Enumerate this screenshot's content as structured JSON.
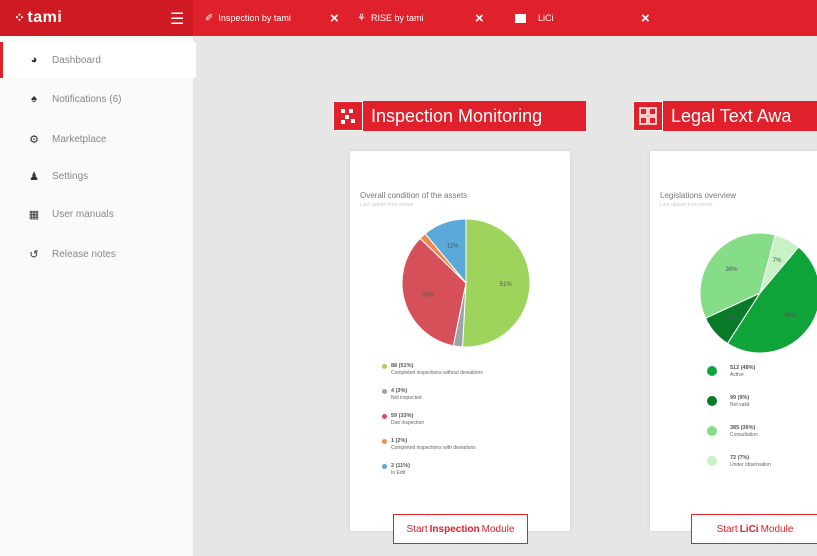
{
  "app": {
    "name": "tami"
  },
  "tabs": [
    {
      "label": "Inspection by tami",
      "icon": "inspection-icon"
    },
    {
      "label": "RISE by tami",
      "icon": "rise-icon"
    },
    {
      "label": "LiCi",
      "icon": "lici-icon"
    }
  ],
  "sidebar": {
    "items": [
      {
        "label": "Dashboard",
        "icon": "dashboard-icon",
        "active": true
      },
      {
        "label": "Notifications (6)",
        "icon": "bell-icon"
      },
      {
        "label": "Marketplace",
        "icon": "marketplace-icon"
      },
      {
        "label": "Settings",
        "icon": "users-settings-icon"
      },
      {
        "label": "User manuals",
        "icon": "manual-icon"
      },
      {
        "label": "Release notes",
        "icon": "history-icon"
      }
    ]
  },
  "modules": {
    "inspection": {
      "title": "Inspection Monitoring",
      "card_title": "Overall condition of the assets",
      "card_subtitle": "Last update from vessel",
      "button": {
        "prefix": "Start",
        "bold": "Inspection",
        "suffix": "Module"
      }
    },
    "legal": {
      "title": "Legal Text Awa",
      "card_title": "Legislations overview",
      "card_subtitle": "Last update from server",
      "button": {
        "prefix": "Start",
        "bold": "LiCi",
        "suffix": "Module"
      }
    }
  },
  "chart_data": [
    {
      "type": "pie",
      "title": "Overall condition of the assets",
      "series": [
        {
          "label": "Completed inspections without deviations",
          "value": 88,
          "display": "88 (51%)",
          "slice_label": "51%",
          "color": "#9ed35c"
        },
        {
          "label": "Not inspected",
          "value": 4,
          "display": "4 (3%)",
          "color": "#9aa4aa"
        },
        {
          "label": "Due inspection",
          "value": 59,
          "display": "59 (33%)",
          "slice_label": "33%",
          "color": "#d6505a"
        },
        {
          "label": "Completed inspections with deviations",
          "value": 3,
          "display": "1 (2%)",
          "color": "#f28a4a"
        },
        {
          "label": "In Edit",
          "value": 19,
          "display": "2 (11%)",
          "slice_label": "11%",
          "color": "#5aa9d8"
        }
      ]
    },
    {
      "type": "pie",
      "title": "Legislations overview",
      "series": [
        {
          "label": "Active",
          "value": 48,
          "display": "512 (48%)",
          "slice_label": "48%",
          "color": "#0ea43a"
        },
        {
          "label": "Not valid",
          "value": 9,
          "display": "99 (9%)",
          "slice_label": "9%",
          "color": "#087a2a"
        },
        {
          "label": "Consultation",
          "value": 36,
          "display": "385 (36%)",
          "slice_label": "36%",
          "color": "#86dd88"
        },
        {
          "label": "Under observation",
          "value": 7,
          "display": "72 (7%)",
          "slice_label": "7%",
          "color": "#c8f2c6"
        }
      ]
    }
  ]
}
